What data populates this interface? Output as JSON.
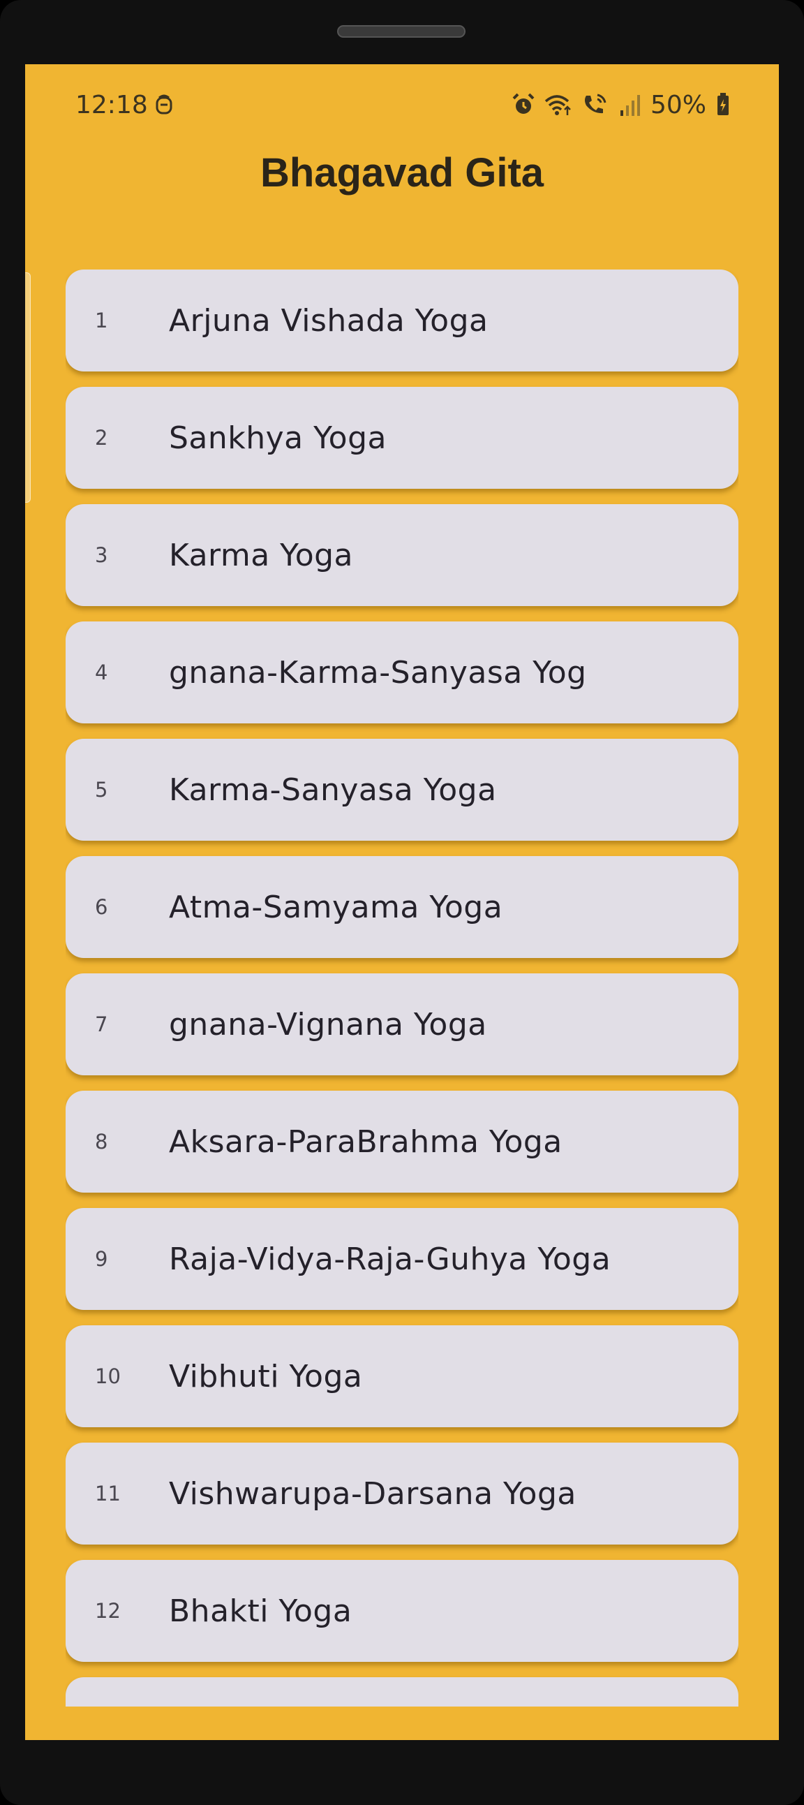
{
  "status_bar": {
    "time": "12:18",
    "battery": "50%",
    "icons": [
      "face-recognition-icon",
      "alarm-icon",
      "wifi-icon",
      "volte-call-icon",
      "signal-icon",
      "battery-icon"
    ]
  },
  "app": {
    "title": "Bhagavad Gita"
  },
  "chapters": [
    {
      "number": "1",
      "title": "Arjuna Vishada Yoga"
    },
    {
      "number": "2",
      "title": "Sankhya Yoga"
    },
    {
      "number": "3",
      "title": "Karma Yoga"
    },
    {
      "number": "4",
      "title": "gnana-Karma-Sanyasa Yog"
    },
    {
      "number": "5",
      "title": "Karma-Sanyasa Yoga"
    },
    {
      "number": "6",
      "title": "Atma-Samyama Yoga"
    },
    {
      "number": "7",
      "title": "gnana-Vignana Yoga"
    },
    {
      "number": "8",
      "title": "Aksara-ParaBrahma Yoga"
    },
    {
      "number": "9",
      "title": "Raja-Vidya-Raja-Guhya Yoga"
    },
    {
      "number": "10",
      "title": "Vibhuti Yoga"
    },
    {
      "number": "11",
      "title": "Vishwarupa-Darsana Yoga"
    },
    {
      "number": "12",
      "title": "Bhakti Yoga"
    },
    {
      "number": "",
      "title": ""
    }
  ],
  "colors": {
    "background": "#F0B532",
    "card": "#E1DEE6",
    "text": "#24212a"
  }
}
